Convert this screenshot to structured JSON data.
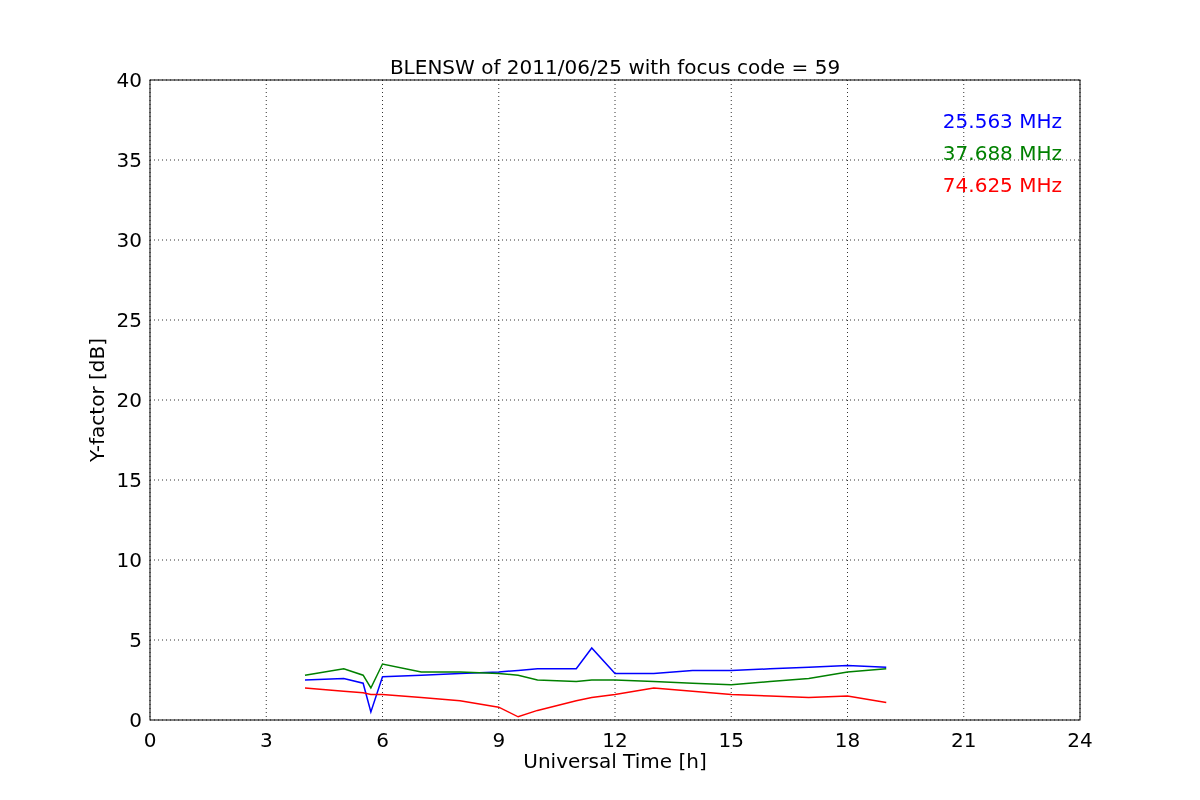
{
  "figure": {
    "chart_data": {
      "type": "line",
      "title": "BLENSW of 2011/06/25 with focus code = 59",
      "xlabel": "Universal Time [h]",
      "ylabel": "Y-factor [dB]",
      "x": [
        4,
        5,
        5.5,
        5.7,
        6,
        7,
        8,
        9,
        9.5,
        10,
        11,
        11.4,
        12,
        13,
        14,
        15,
        16,
        17,
        18,
        19
      ],
      "series": [
        {
          "name": "25.563 MHz",
          "color": "#0000ff",
          "values": [
            2.5,
            2.6,
            2.3,
            0.5,
            2.7,
            2.8,
            2.9,
            3.0,
            3.1,
            3.2,
            3.2,
            4.5,
            2.9,
            2.9,
            3.1,
            3.1,
            3.2,
            3.3,
            3.4,
            3.3
          ]
        },
        {
          "name": "37.688 MHz",
          "color": "#008000",
          "values": [
            2.8,
            3.2,
            2.8,
            2.0,
            3.5,
            3.0,
            3.0,
            2.9,
            2.8,
            2.5,
            2.4,
            2.5,
            2.5,
            2.4,
            2.3,
            2.2,
            2.4,
            2.6,
            3.0,
            3.2
          ]
        },
        {
          "name": "74.625 MHz",
          "color": "#ff0000",
          "values": [
            2.0,
            1.8,
            1.7,
            1.6,
            1.6,
            1.4,
            1.2,
            0.8,
            0.2,
            0.6,
            1.2,
            1.4,
            1.6,
            2.0,
            1.8,
            1.6,
            1.5,
            1.4,
            1.5,
            1.1
          ]
        }
      ],
      "grid": true,
      "xlim": [
        0,
        24
      ],
      "ylim": [
        0,
        40
      ],
      "xticks": [
        0,
        3,
        6,
        9,
        12,
        15,
        18,
        21,
        24
      ],
      "yticks": [
        0,
        5,
        10,
        15,
        20,
        25,
        30,
        35,
        40
      ]
    }
  }
}
